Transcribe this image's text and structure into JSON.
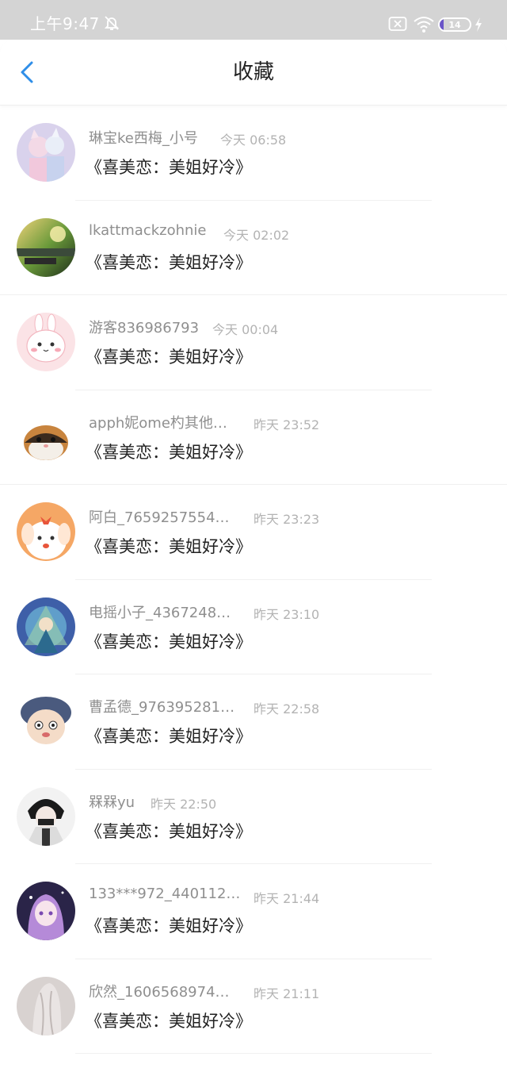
{
  "status_bar": {
    "time": "上午9:47",
    "battery": "14",
    "battery_level": 0.14,
    "icons": [
      "mute-bell-icon",
      "sim-off-icon",
      "wifi-icon",
      "battery-icon",
      "charging-icon"
    ]
  },
  "header": {
    "title": "收藏",
    "back_icon": "chevron-left-icon",
    "accent": "#2f8ee8"
  },
  "favorites": [
    {
      "user": "琳宝ke西梅_小号",
      "time": "今天 06:58",
      "title": "《喜美恋：美姐好冷》"
    },
    {
      "user": "lkattmackzohnie",
      "time": "今天 02:02",
      "title": "《喜美恋：美姐好冷》"
    },
    {
      "user": "游客836986793",
      "time": "今天 00:04",
      "title": "《喜美恋：美姐好冷》"
    },
    {
      "user": "apph妮ome杓其他…",
      "time": "昨天 23:52",
      "title": "《喜美恋：美姐好冷》"
    },
    {
      "user": "阿白_7659257554…",
      "time": "昨天 23:23",
      "title": "《喜美恋：美姐好冷》"
    },
    {
      "user": "电摇小子_4367248…",
      "time": "昨天 23:10",
      "title": "《喜美恋：美姐好冷》"
    },
    {
      "user": "曹孟德_976395281…",
      "time": "昨天 22:58",
      "title": "《喜美恋：美姐好冷》"
    },
    {
      "user": "槑槑yu",
      "time": "昨天 22:50",
      "title": "《喜美恋：美姐好冷》"
    },
    {
      "user": "133***972_440112…",
      "time": "昨天 21:44",
      "title": "《喜美恋：美姐好冷》"
    },
    {
      "user": "欣然_1606568974…",
      "time": "昨天 21:11",
      "title": "《喜美恋：美姐好冷》"
    }
  ]
}
